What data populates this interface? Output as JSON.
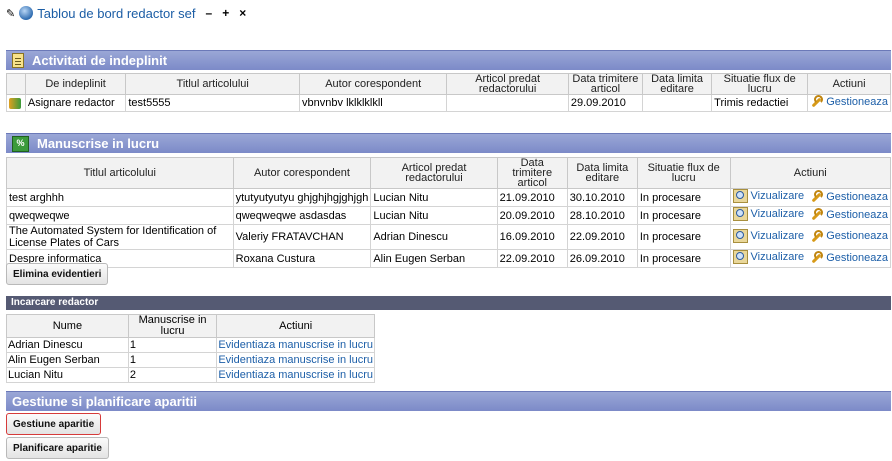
{
  "header": {
    "title": "Tablou de bord redactor sef",
    "minimize": "–",
    "add": "+",
    "close": "×"
  },
  "tasks": {
    "title": "Activitati de indeplinit",
    "columns": [
      "",
      "De indeplinit",
      "Titlul articolului",
      "Autor corespondent",
      "Articol predat redactorului",
      "Data trimitere articol",
      "Data limita editare",
      "Situatie flux de lucru",
      "Actiuni"
    ],
    "rows": [
      {
        "task": "Asignare redactor",
        "title": "test5555",
        "author": "vbnvnbv lklklklkll",
        "editor": "",
        "sent": "29.09.2010",
        "deadline": "",
        "status": "Trimis redactiei",
        "action": "Gestioneaza"
      }
    ]
  },
  "manuscripts": {
    "title": "Manuscrise in lucru",
    "columns": [
      "Titlul articolului",
      "Autor corespondent",
      "Articol predat redactorului",
      "Data trimitere articol",
      "Data limita editare",
      "Situatie flux de lucru",
      "Actiuni"
    ],
    "view_label": "Vizualizare",
    "manage_label": "Gestioneaza",
    "rows": [
      {
        "title": "test arghhh",
        "author": "ytutyutyutyu ghjghjhgjghjgh",
        "editor": "Lucian Nitu",
        "sent": "21.09.2010",
        "deadline": "30.10.2010",
        "status": "In procesare"
      },
      {
        "title": "qweqweqwe",
        "author": "qweqweqwe asdasdas",
        "editor": "Lucian Nitu",
        "sent": "20.09.2010",
        "deadline": "28.10.2010",
        "status": "In procesare"
      },
      {
        "title": "The Automated System for Identification of License Plates of Cars",
        "author": "Valeriy FRATAVCHAN",
        "editor": "Adrian Dinescu",
        "sent": "16.09.2010",
        "deadline": "22.09.2010",
        "status": "In procesare"
      },
      {
        "title": "Despre informatica",
        "author": "Roxana Custura",
        "editor": "Alin Eugen Serban",
        "sent": "22.09.2010",
        "deadline": "26.09.2010",
        "status": "In procesare"
      }
    ]
  },
  "clear_button": "Elimina evidentieri",
  "load": {
    "title": "Incarcare redactor",
    "columns": [
      "Nume",
      "Manuscrise in lucru",
      "Actiuni"
    ],
    "action_label": "Evidentiaza manuscrise in lucru",
    "rows": [
      {
        "name": "Adrian Dinescu",
        "count": "1"
      },
      {
        "name": "Alin Eugen Serban",
        "count": "1"
      },
      {
        "name": "Lucian Nitu",
        "count": "2"
      }
    ]
  },
  "planning": {
    "title": "Gestiune si planificare aparitii",
    "btn_manage": "Gestiune aparitie",
    "btn_plan": "Planificare aparitie"
  }
}
